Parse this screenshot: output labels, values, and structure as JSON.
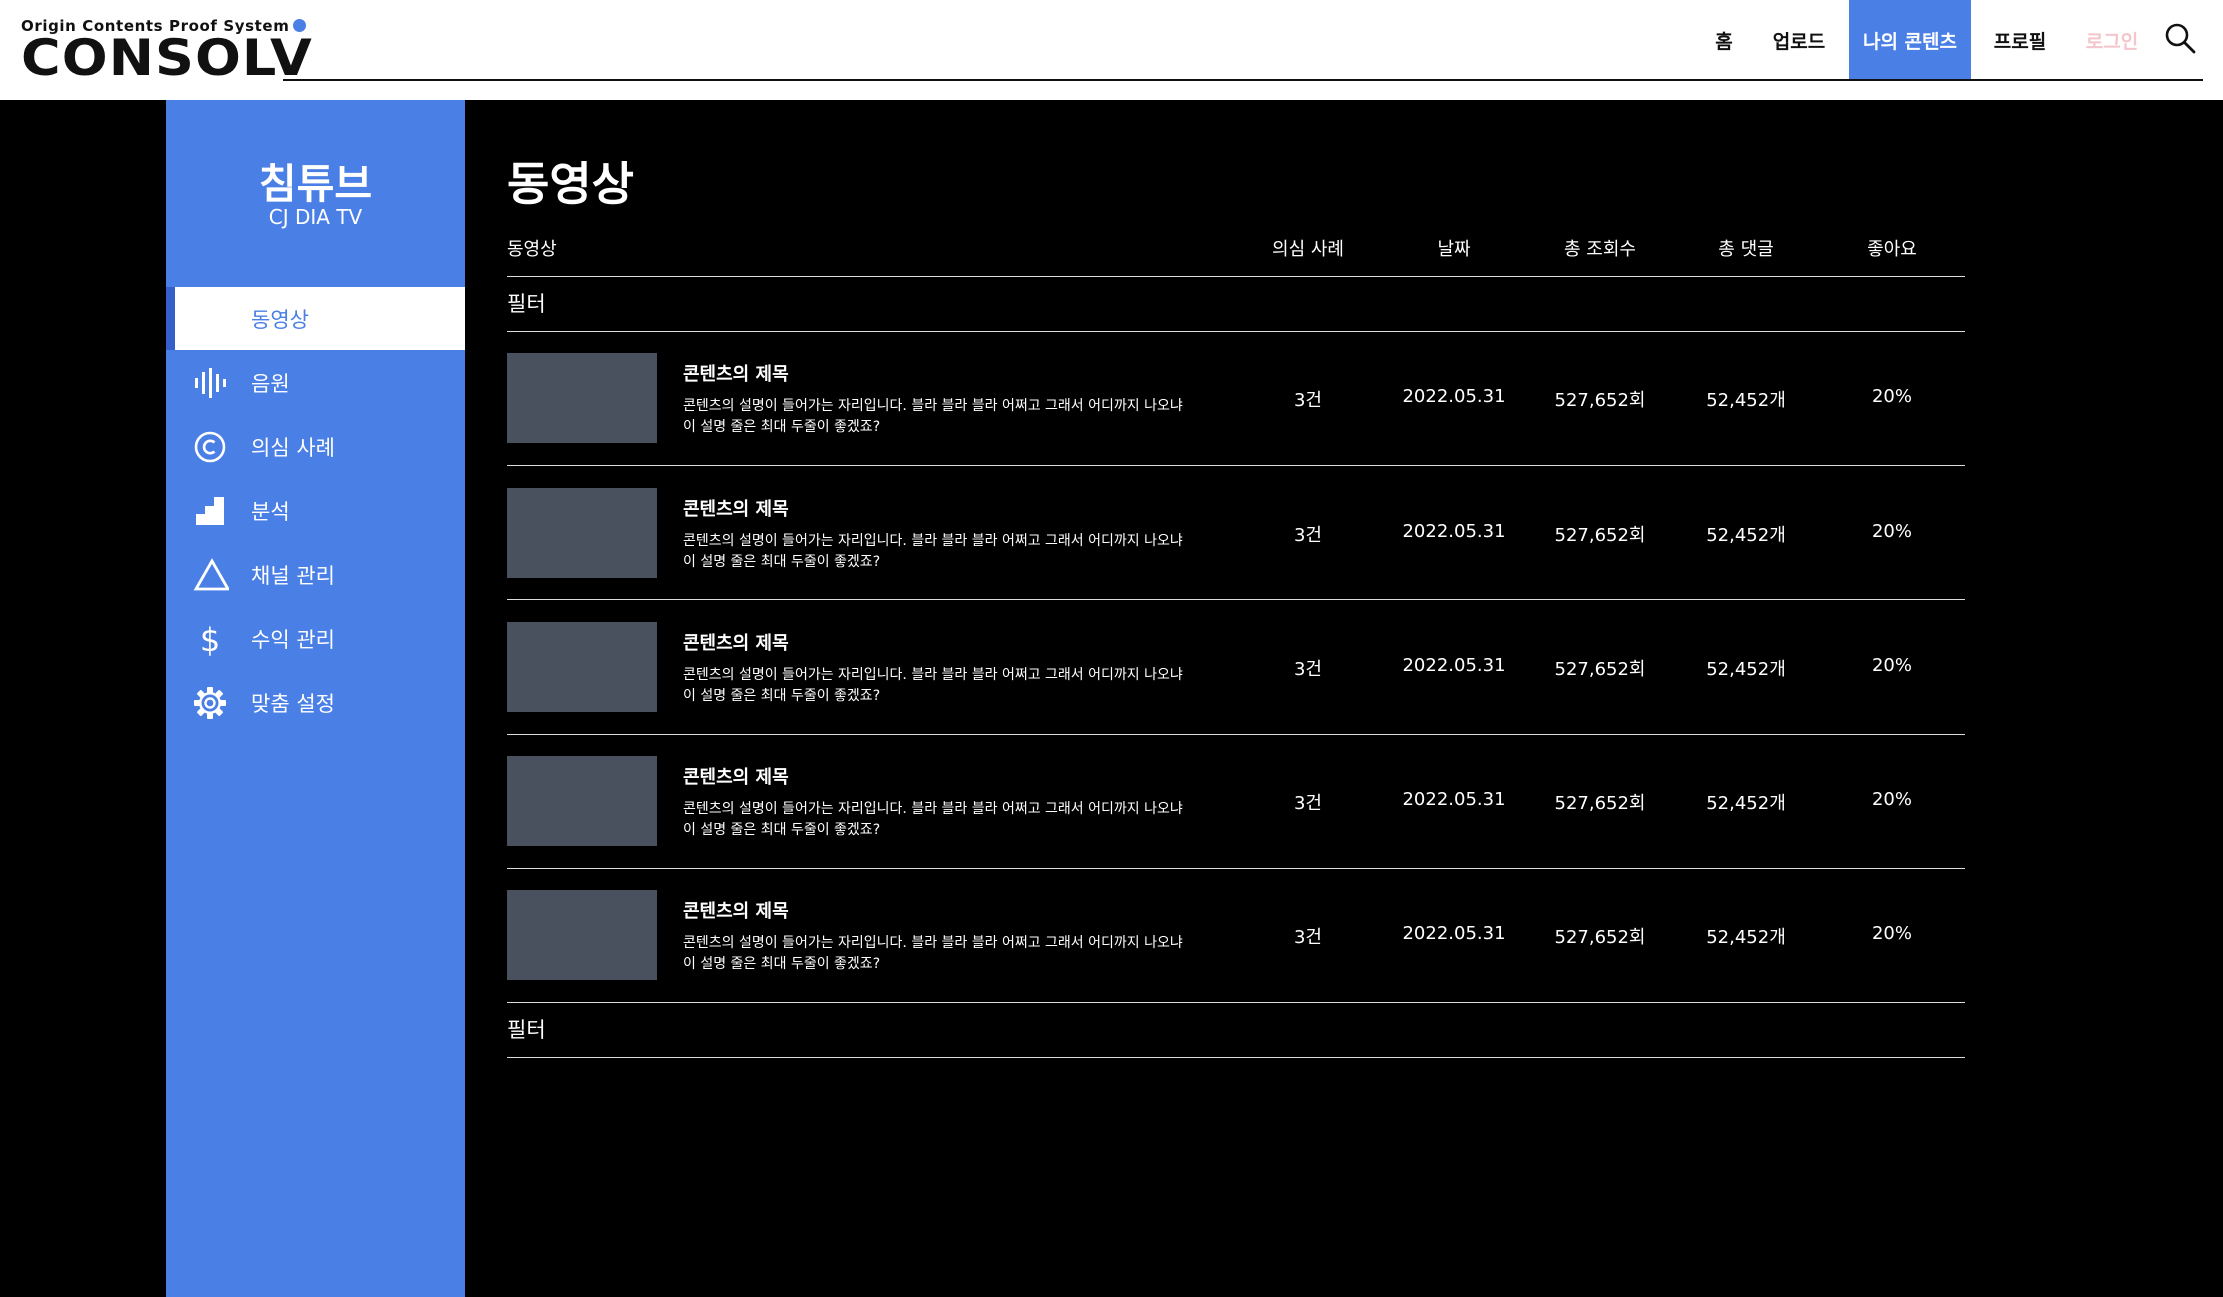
{
  "logo": {
    "tagline": "Origin Contents Proof System",
    "wordmark": "CONSOLV"
  },
  "nav": {
    "home": "홈",
    "upload": "업로드",
    "my_contents": "나의 콘텐츠",
    "profile": "프로필",
    "login": "로그인",
    "search_icon": "search-icon"
  },
  "colors": {
    "accent": "#4a7fe6",
    "background": "#000000",
    "thumbnail": "#4a515e",
    "login_text": "#f3c6cc"
  },
  "sidebar": {
    "channel_name": "침튜브",
    "channel_sub": "CJ DIA TV",
    "items": [
      {
        "label": "동영상",
        "icon": "",
        "active": true
      },
      {
        "label": "음원",
        "icon": "audio-wave-icon"
      },
      {
        "label": "의심 사례",
        "icon": "copyright-icon"
      },
      {
        "label": "분석",
        "icon": "chart-steps-icon"
      },
      {
        "label": "채널 관리",
        "icon": "triangle-icon"
      },
      {
        "label": "수익 관리",
        "icon": "dollar-icon"
      },
      {
        "label": "맞춤 설정",
        "icon": "gear-icon"
      }
    ]
  },
  "main": {
    "title": "동영상",
    "columns": {
      "video": "동영상",
      "suspect": "의심 사례",
      "date": "날짜",
      "views": "총 조회수",
      "comments": "총 댓글",
      "likes": "좋아요"
    },
    "filter_top": "필터",
    "filter_bottom": "필터",
    "rows": [
      {
        "title": "콘텐츠의 제목",
        "description": "콘텐츠의 설명이 들어가는 자리입니다. 블라 블라 블라 어쩌고 그래서 어디까지 나오냐 이 설명 줄은 최대 두줄이 좋겠죠?",
        "suspect": "3건",
        "date": "2022.05.31",
        "views": "527,652회",
        "comments": "52,452개",
        "likes": "20%"
      },
      {
        "title": "콘텐츠의 제목",
        "description": "콘텐츠의 설명이 들어가는 자리입니다. 블라 블라 블라 어쩌고 그래서 어디까지 나오냐 이 설명 줄은 최대 두줄이 좋겠죠?",
        "suspect": "3건",
        "date": "2022.05.31",
        "views": "527,652회",
        "comments": "52,452개",
        "likes": "20%"
      },
      {
        "title": "콘텐츠의 제목",
        "description": "콘텐츠의 설명이 들어가는 자리입니다. 블라 블라 블라 어쩌고 그래서 어디까지 나오냐 이 설명 줄은 최대 두줄이 좋겠죠?",
        "suspect": "3건",
        "date": "2022.05.31",
        "views": "527,652회",
        "comments": "52,452개",
        "likes": "20%"
      },
      {
        "title": "콘텐츠의 제목",
        "description": "콘텐츠의 설명이 들어가는 자리입니다. 블라 블라 블라 어쩌고 그래서 어디까지 나오냐 이 설명 줄은 최대 두줄이 좋겠죠?",
        "suspect": "3건",
        "date": "2022.05.31",
        "views": "527,652회",
        "comments": "52,452개",
        "likes": "20%"
      },
      {
        "title": "콘텐츠의 제목",
        "description": "콘텐츠의 설명이 들어가는 자리입니다. 블라 블라 블라 어쩌고 그래서 어디까지 나오냐 이 설명 줄은 최대 두줄이 좋겠죠?",
        "suspect": "3건",
        "date": "2022.05.31",
        "views": "527,652회",
        "comments": "52,452개",
        "likes": "20%"
      }
    ]
  }
}
